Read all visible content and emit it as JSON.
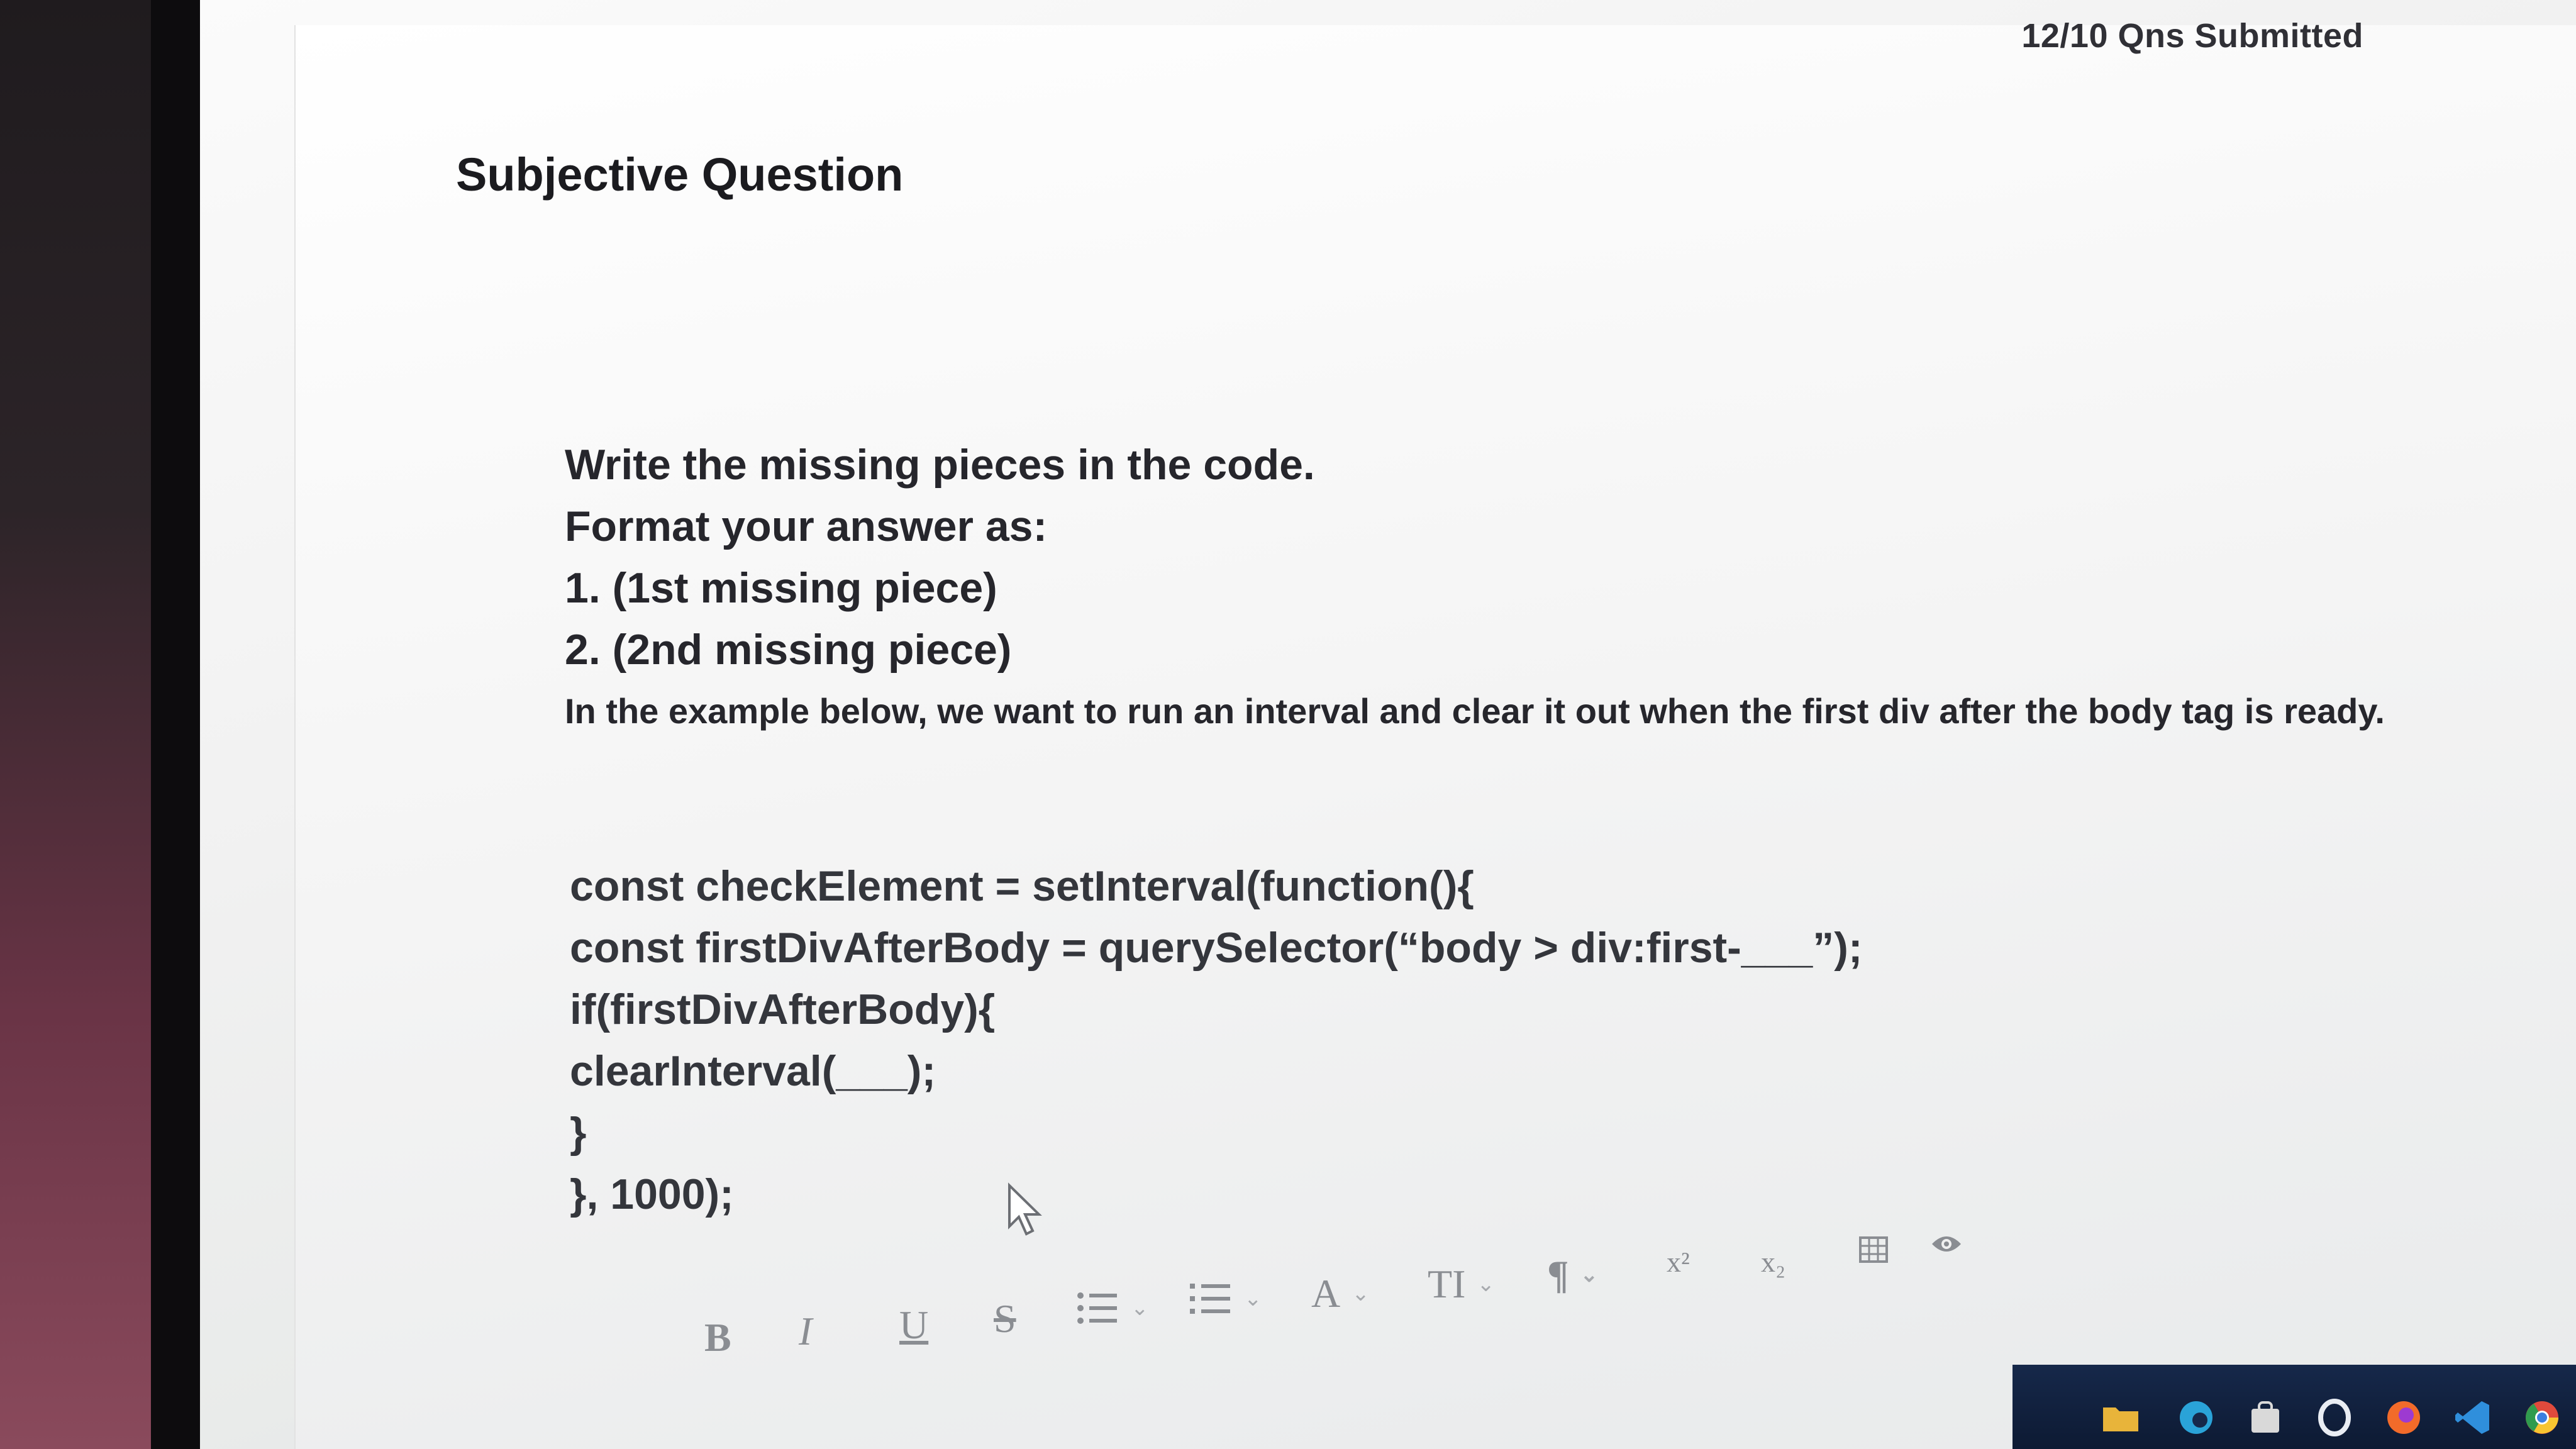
{
  "header": {
    "progress_label": "12/10 Qns Submitted"
  },
  "section_title": "Subjective Question",
  "question": {
    "lines": [
      "Write the missing pieces in the code.",
      "Format your answer as:",
      "1. (1st missing piece)",
      "2. (2nd missing piece)",
      "In the example below, we want to run an interval and clear it out when the first div after the body tag is ready."
    ]
  },
  "code": {
    "lines": [
      "const checkElement = setInterval(function(){",
      "const firstDivAfterBody = querySelector(“body > div:first-___”);",
      "if(firstDivAfterBody){",
      "clearInterval(___);",
      "}",
      "}, 1000);"
    ]
  },
  "toolbar": {
    "bold": "B",
    "italic": "I",
    "underline": "U",
    "strikethrough": "S",
    "font_color": "A",
    "text_size": "TI",
    "paragraph": "¶",
    "superscript": "x²",
    "subscript": "x₂",
    "icons": [
      "bold-icon",
      "italic-icon",
      "underline-icon",
      "strikethrough-icon",
      "bullet-list-icon",
      "numbered-list-icon",
      "font-color-icon",
      "text-size-icon",
      "paragraph-icon",
      "superscript-icon",
      "subscript-icon",
      "table-icon",
      "preview-eye-icon"
    ]
  },
  "taskbar": {
    "icons": [
      "folder-icon",
      "edge-browser-icon",
      "store-icon",
      "opera-icon",
      "firefox-icon",
      "vscode-icon",
      "chrome-icon"
    ]
  },
  "colors": {
    "text": "#26262c",
    "toolbar_icon": "#8a8d92",
    "taskbar": "#0d1a33"
  }
}
